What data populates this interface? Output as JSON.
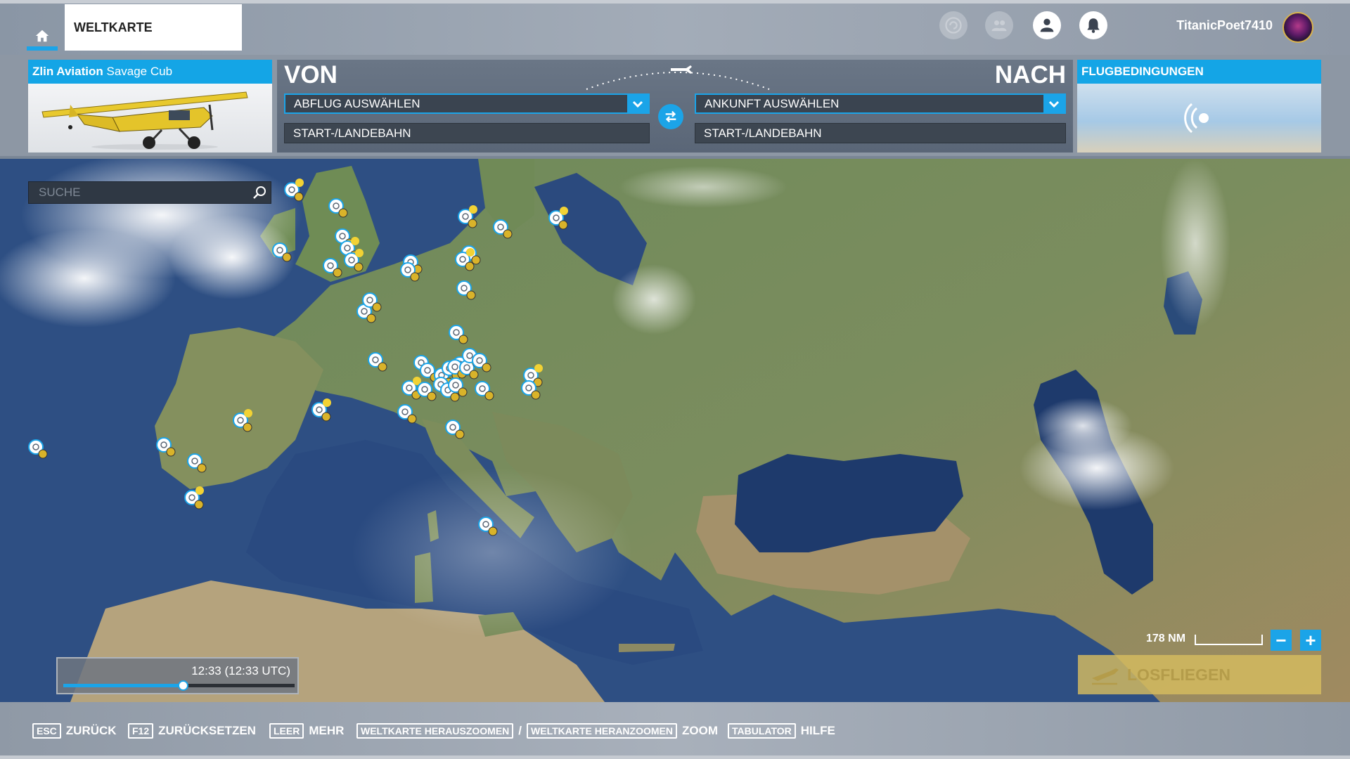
{
  "header": {
    "tab_label": "WELTKARTE",
    "username": "TitanicPoet7410",
    "icons": [
      "home-icon",
      "activity-icon",
      "friends-icon",
      "profile-icon",
      "notification-icon"
    ]
  },
  "aircraft": {
    "brand": "Zlin Aviation",
    "model": "Savage Cub"
  },
  "route": {
    "from_label": "VON",
    "to_label": "NACH",
    "departure_placeholder": "ABFLUG AUSWÄHLEN",
    "arrival_placeholder": "ANKUNFT AUSWÄHLEN",
    "departure_runway": "START-/LANDEBAHN",
    "arrival_runway": "START-/LANDEBAHN"
  },
  "conditions": {
    "title": "FLUGBEDINGUNGEN"
  },
  "map": {
    "search_placeholder": "SUCHE",
    "time_display": "12:33 (12:33 UTC)",
    "time_progress_pct": 52,
    "scale_label": "178 NM",
    "zoom_out": "−",
    "zoom_in": "+",
    "fly_button": "LOSFLIEGEN"
  },
  "footer": {
    "hints": [
      {
        "key": "ESC",
        "label": "ZURÜCK"
      },
      {
        "key": "F12",
        "label": "ZURÜCKSETZEN"
      },
      {
        "key": "LEER",
        "label": "MEHR"
      },
      {
        "key": "WELTKARTE HERAUSZOOMEN",
        "separator": "/",
        "key2": "WELTKARTE HERANZOOMEN",
        "label": "ZOOM"
      },
      {
        "key": "TABULATOR",
        "label": "HILFE"
      }
    ]
  },
  "colors": {
    "accent": "#1ba4e8",
    "fly_button": "#d6bc5f",
    "poi_star": "#d9b32a"
  }
}
